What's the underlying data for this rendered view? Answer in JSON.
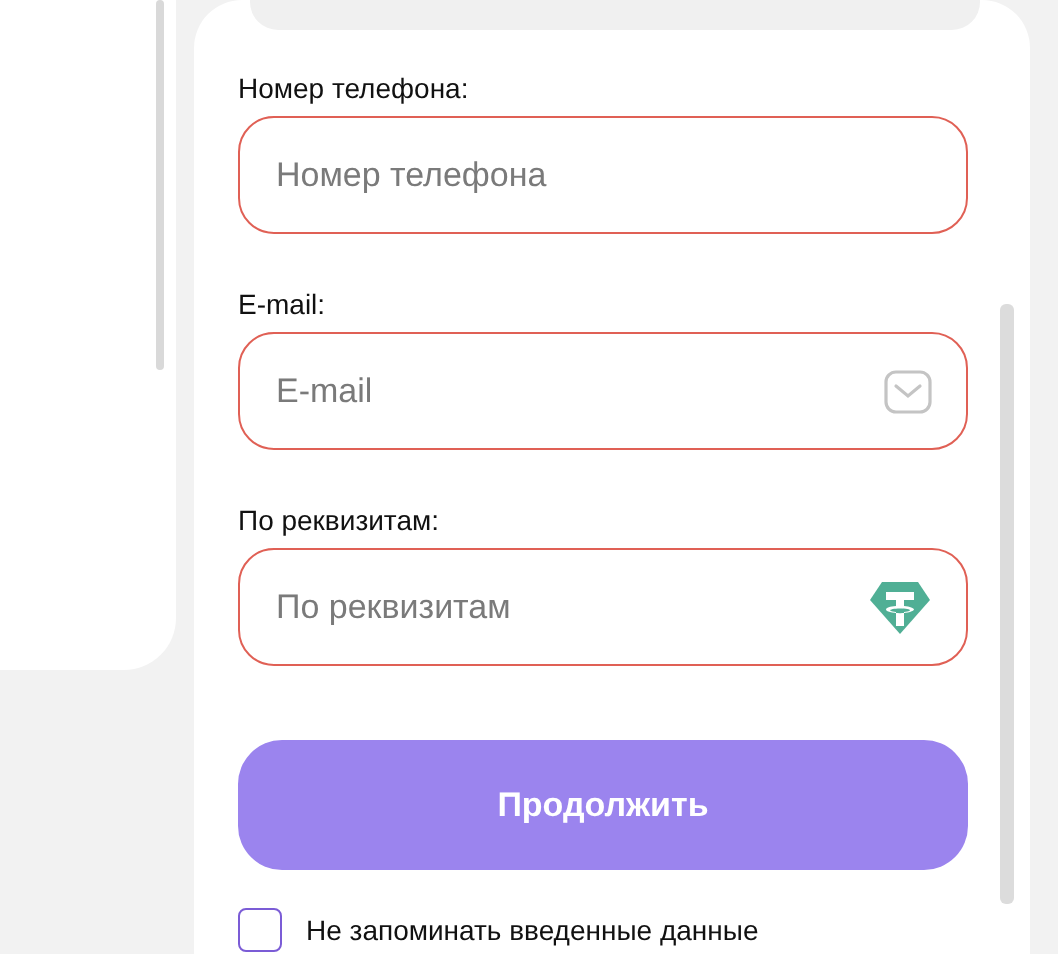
{
  "fields": [
    {
      "kind": "text",
      "label": "Номер телефона:",
      "placeholder": "Номер телефона",
      "invalid": true
    },
    {
      "kind": "email",
      "label": "E-mail:",
      "placeholder": "E-mail",
      "invalid": true
    },
    {
      "kind": "token",
      "label": "По реквизитам:",
      "placeholder": "По реквизитам",
      "invalid": true
    }
  ],
  "submit_button": {
    "label": "Продолжить"
  },
  "remember_option": {
    "label": "Не запоминать введенные данные",
    "checked": false
  }
}
